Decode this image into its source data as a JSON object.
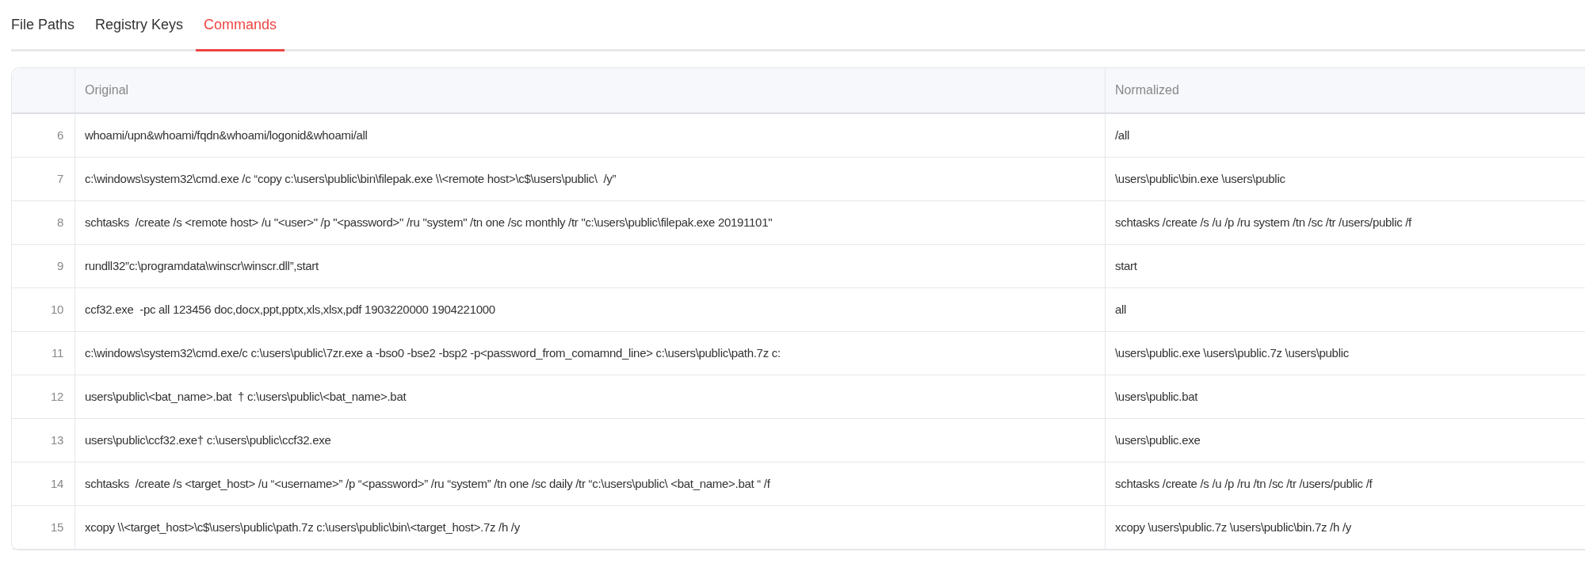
{
  "tabs": [
    {
      "label": "File Paths",
      "selected": false
    },
    {
      "label": "Registry Keys",
      "selected": false
    },
    {
      "label": "Commands",
      "selected": true
    }
  ],
  "table": {
    "columns": [
      "Original",
      "Normalized"
    ],
    "rows": [
      {
        "index": "6",
        "original": "whoami/upn&whoami/fqdn&whoami/logonid&whoami/all",
        "normalized": "/all"
      },
      {
        "index": "7",
        "original": "c:\\windows\\system32\\cmd.exe /c “copy c:\\users\\public\\bin\\filepak.exe \\\\<remote host>\\c$\\users\\public\\  /y”",
        "normalized": "\\users\\public\\bin.exe \\users\\public"
      },
      {
        "index": "8",
        "original": "schtasks  /create /s <remote host> /u \"<user>\" /p \"<password>\" /ru \"system\" /tn one /sc monthly /tr \"c:\\users\\public\\filepak.exe 20191101\"",
        "normalized": "schtasks /create /s /u /p /ru system /tn /sc /tr /users/public /f"
      },
      {
        "index": "9",
        "original": "rundll32”c:\\programdata\\winscr\\winscr.dll”,start",
        "normalized": "start"
      },
      {
        "index": "10",
        "original": "ccf32.exe  -pc all 123456 doc,docx,ppt,pptx,xls,xlsx,pdf 1903220000 1904221000",
        "normalized": "all"
      },
      {
        "index": "11",
        "original": "c:\\windows\\system32\\cmd.exe/c c:\\users\\public\\7zr.exe a -bso0 -bse2 -bsp2 -p<password_from_comamnd_line> c:\\users\\public\\path.7z c:",
        "normalized": "\\users\\public.exe \\users\\public.7z \\users\\public"
      },
      {
        "index": "12",
        "original": "users\\public\\<bat_name>.bat  † c:\\users\\public\\<bat_name>.bat",
        "normalized": "\\users\\public.bat"
      },
      {
        "index": "13",
        "original": "users\\public\\ccf32.exe† c:\\users\\public\\ccf32.exe",
        "normalized": "\\users\\public.exe"
      },
      {
        "index": "14",
        "original": "schtasks  /create /s <target_host> /u “<username>” /p “<password>” /ru “system” /tn one /sc daily /tr “c:\\users\\public\\ <bat_name>.bat “ /f",
        "normalized": "schtasks /create /s /u /p /ru /tn /sc /tr /users/public /f"
      },
      {
        "index": "15",
        "original": "xcopy \\\\<target_host>\\c$\\users\\public\\path.7z c:\\users\\public\\bin\\<target_host>.7z /h /y",
        "normalized": "xcopy \\users\\public.7z \\users\\public\\bin.7z /h /y"
      }
    ]
  }
}
